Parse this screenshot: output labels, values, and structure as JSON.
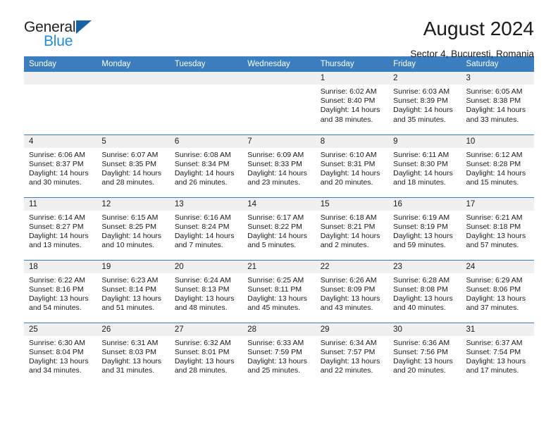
{
  "brand": {
    "name_top": "General",
    "name_bottom": "Blue",
    "triangle_color": "#1763a8",
    "blue_text_color": "#1f8fe0"
  },
  "header": {
    "title": "August 2024",
    "subtitle": "Sector 4, Bucuresti, Romania"
  },
  "theme": {
    "header_row_bg": "#3a7ebf",
    "daynum_bg": "#f0f0f0",
    "text": "#1a1a1a"
  },
  "weekday_headers": [
    "Sunday",
    "Monday",
    "Tuesday",
    "Wednesday",
    "Thursday",
    "Friday",
    "Saturday"
  ],
  "weeks": [
    [
      {
        "day": "",
        "sunrise": "",
        "sunset": "",
        "daylight_1": "",
        "daylight_2": ""
      },
      {
        "day": "",
        "sunrise": "",
        "sunset": "",
        "daylight_1": "",
        "daylight_2": ""
      },
      {
        "day": "",
        "sunrise": "",
        "sunset": "",
        "daylight_1": "",
        "daylight_2": ""
      },
      {
        "day": "",
        "sunrise": "",
        "sunset": "",
        "daylight_1": "",
        "daylight_2": ""
      },
      {
        "day": "1",
        "sunrise": "Sunrise: 6:02 AM",
        "sunset": "Sunset: 8:40 PM",
        "daylight_1": "Daylight: 14 hours",
        "daylight_2": "and 38 minutes."
      },
      {
        "day": "2",
        "sunrise": "Sunrise: 6:03 AM",
        "sunset": "Sunset: 8:39 PM",
        "daylight_1": "Daylight: 14 hours",
        "daylight_2": "and 35 minutes."
      },
      {
        "day": "3",
        "sunrise": "Sunrise: 6:05 AM",
        "sunset": "Sunset: 8:38 PM",
        "daylight_1": "Daylight: 14 hours",
        "daylight_2": "and 33 minutes."
      }
    ],
    [
      {
        "day": "4",
        "sunrise": "Sunrise: 6:06 AM",
        "sunset": "Sunset: 8:37 PM",
        "daylight_1": "Daylight: 14 hours",
        "daylight_2": "and 30 minutes."
      },
      {
        "day": "5",
        "sunrise": "Sunrise: 6:07 AM",
        "sunset": "Sunset: 8:35 PM",
        "daylight_1": "Daylight: 14 hours",
        "daylight_2": "and 28 minutes."
      },
      {
        "day": "6",
        "sunrise": "Sunrise: 6:08 AM",
        "sunset": "Sunset: 8:34 PM",
        "daylight_1": "Daylight: 14 hours",
        "daylight_2": "and 26 minutes."
      },
      {
        "day": "7",
        "sunrise": "Sunrise: 6:09 AM",
        "sunset": "Sunset: 8:33 PM",
        "daylight_1": "Daylight: 14 hours",
        "daylight_2": "and 23 minutes."
      },
      {
        "day": "8",
        "sunrise": "Sunrise: 6:10 AM",
        "sunset": "Sunset: 8:31 PM",
        "daylight_1": "Daylight: 14 hours",
        "daylight_2": "and 20 minutes."
      },
      {
        "day": "9",
        "sunrise": "Sunrise: 6:11 AM",
        "sunset": "Sunset: 8:30 PM",
        "daylight_1": "Daylight: 14 hours",
        "daylight_2": "and 18 minutes."
      },
      {
        "day": "10",
        "sunrise": "Sunrise: 6:12 AM",
        "sunset": "Sunset: 8:28 PM",
        "daylight_1": "Daylight: 14 hours",
        "daylight_2": "and 15 minutes."
      }
    ],
    [
      {
        "day": "11",
        "sunrise": "Sunrise: 6:14 AM",
        "sunset": "Sunset: 8:27 PM",
        "daylight_1": "Daylight: 14 hours",
        "daylight_2": "and 13 minutes."
      },
      {
        "day": "12",
        "sunrise": "Sunrise: 6:15 AM",
        "sunset": "Sunset: 8:25 PM",
        "daylight_1": "Daylight: 14 hours",
        "daylight_2": "and 10 minutes."
      },
      {
        "day": "13",
        "sunrise": "Sunrise: 6:16 AM",
        "sunset": "Sunset: 8:24 PM",
        "daylight_1": "Daylight: 14 hours",
        "daylight_2": "and 7 minutes."
      },
      {
        "day": "14",
        "sunrise": "Sunrise: 6:17 AM",
        "sunset": "Sunset: 8:22 PM",
        "daylight_1": "Daylight: 14 hours",
        "daylight_2": "and 5 minutes."
      },
      {
        "day": "15",
        "sunrise": "Sunrise: 6:18 AM",
        "sunset": "Sunset: 8:21 PM",
        "daylight_1": "Daylight: 14 hours",
        "daylight_2": "and 2 minutes."
      },
      {
        "day": "16",
        "sunrise": "Sunrise: 6:19 AM",
        "sunset": "Sunset: 8:19 PM",
        "daylight_1": "Daylight: 13 hours",
        "daylight_2": "and 59 minutes."
      },
      {
        "day": "17",
        "sunrise": "Sunrise: 6:21 AM",
        "sunset": "Sunset: 8:18 PM",
        "daylight_1": "Daylight: 13 hours",
        "daylight_2": "and 57 minutes."
      }
    ],
    [
      {
        "day": "18",
        "sunrise": "Sunrise: 6:22 AM",
        "sunset": "Sunset: 8:16 PM",
        "daylight_1": "Daylight: 13 hours",
        "daylight_2": "and 54 minutes."
      },
      {
        "day": "19",
        "sunrise": "Sunrise: 6:23 AM",
        "sunset": "Sunset: 8:14 PM",
        "daylight_1": "Daylight: 13 hours",
        "daylight_2": "and 51 minutes."
      },
      {
        "day": "20",
        "sunrise": "Sunrise: 6:24 AM",
        "sunset": "Sunset: 8:13 PM",
        "daylight_1": "Daylight: 13 hours",
        "daylight_2": "and 48 minutes."
      },
      {
        "day": "21",
        "sunrise": "Sunrise: 6:25 AM",
        "sunset": "Sunset: 8:11 PM",
        "daylight_1": "Daylight: 13 hours",
        "daylight_2": "and 45 minutes."
      },
      {
        "day": "22",
        "sunrise": "Sunrise: 6:26 AM",
        "sunset": "Sunset: 8:09 PM",
        "daylight_1": "Daylight: 13 hours",
        "daylight_2": "and 43 minutes."
      },
      {
        "day": "23",
        "sunrise": "Sunrise: 6:28 AM",
        "sunset": "Sunset: 8:08 PM",
        "daylight_1": "Daylight: 13 hours",
        "daylight_2": "and 40 minutes."
      },
      {
        "day": "24",
        "sunrise": "Sunrise: 6:29 AM",
        "sunset": "Sunset: 8:06 PM",
        "daylight_1": "Daylight: 13 hours",
        "daylight_2": "and 37 minutes."
      }
    ],
    [
      {
        "day": "25",
        "sunrise": "Sunrise: 6:30 AM",
        "sunset": "Sunset: 8:04 PM",
        "daylight_1": "Daylight: 13 hours",
        "daylight_2": "and 34 minutes."
      },
      {
        "day": "26",
        "sunrise": "Sunrise: 6:31 AM",
        "sunset": "Sunset: 8:03 PM",
        "daylight_1": "Daylight: 13 hours",
        "daylight_2": "and 31 minutes."
      },
      {
        "day": "27",
        "sunrise": "Sunrise: 6:32 AM",
        "sunset": "Sunset: 8:01 PM",
        "daylight_1": "Daylight: 13 hours",
        "daylight_2": "and 28 minutes."
      },
      {
        "day": "28",
        "sunrise": "Sunrise: 6:33 AM",
        "sunset": "Sunset: 7:59 PM",
        "daylight_1": "Daylight: 13 hours",
        "daylight_2": "and 25 minutes."
      },
      {
        "day": "29",
        "sunrise": "Sunrise: 6:34 AM",
        "sunset": "Sunset: 7:57 PM",
        "daylight_1": "Daylight: 13 hours",
        "daylight_2": "and 22 minutes."
      },
      {
        "day": "30",
        "sunrise": "Sunrise: 6:36 AM",
        "sunset": "Sunset: 7:56 PM",
        "daylight_1": "Daylight: 13 hours",
        "daylight_2": "and 20 minutes."
      },
      {
        "day": "31",
        "sunrise": "Sunrise: 6:37 AM",
        "sunset": "Sunset: 7:54 PM",
        "daylight_1": "Daylight: 13 hours",
        "daylight_2": "and 17 minutes."
      }
    ]
  ]
}
